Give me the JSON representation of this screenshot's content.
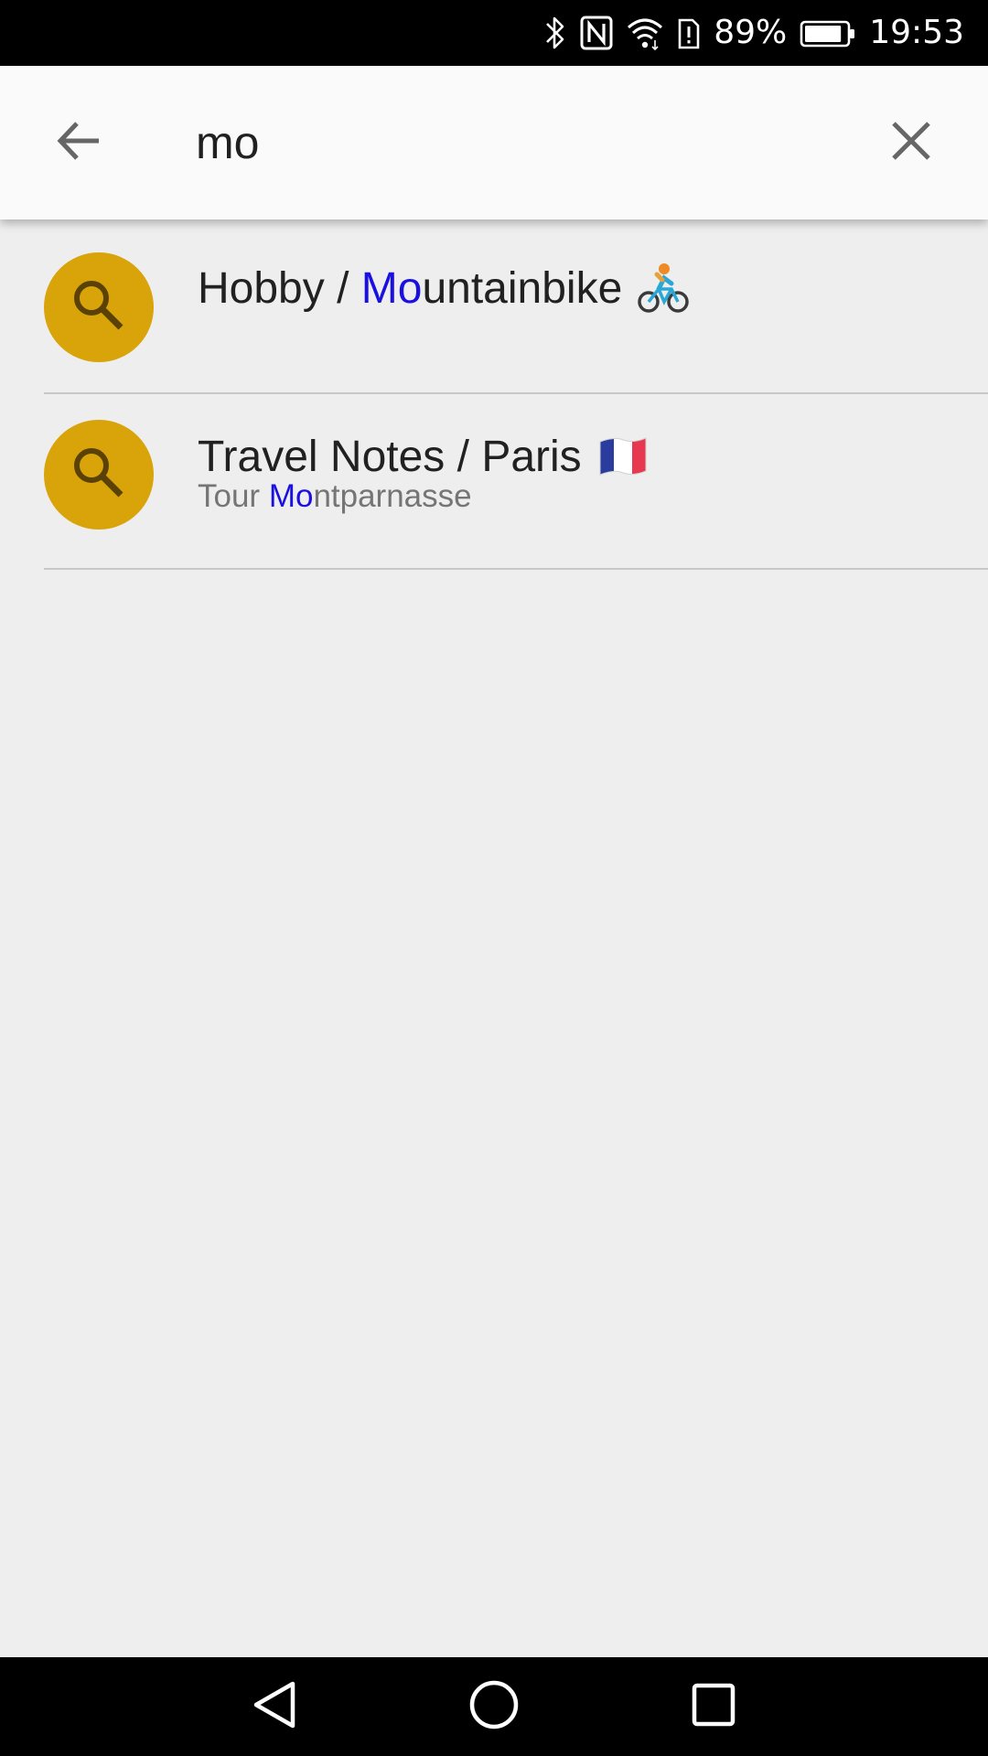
{
  "status_bar": {
    "battery_percent": "89%",
    "time": "19:53",
    "battery_level": 0.89,
    "icons": [
      "bluetooth-icon",
      "nfc-icon",
      "wifi-icon",
      "sim-alert-icon",
      "battery-icon"
    ]
  },
  "search": {
    "query": "mo",
    "back_icon": "arrow-left-icon",
    "clear_icon": "close-icon"
  },
  "results": [
    {
      "icon": "search-icon",
      "title_prefix": "Hobby / ",
      "title_match": "Mo",
      "title_rest": "untainbike",
      "title_emoji": "cyclist-emoji",
      "subtitle_prefix": "",
      "subtitle_match": "",
      "subtitle_rest": ""
    },
    {
      "icon": "search-icon",
      "title_prefix": "Travel Notes / Paris",
      "title_match": "",
      "title_rest": "",
      "title_emoji": "france-flag-emoji",
      "subtitle_prefix": "Tour ",
      "subtitle_match": "Mo",
      "subtitle_rest": "ntparnasse"
    }
  ],
  "colors": {
    "accent_avatar": "#d9a30a",
    "highlight": "#1a10e0",
    "background": "#eeeeee",
    "search_bar": "#fafafa"
  },
  "nav_bar": {
    "icons": [
      "back-triangle-icon",
      "home-circle-icon",
      "recents-square-icon"
    ]
  }
}
